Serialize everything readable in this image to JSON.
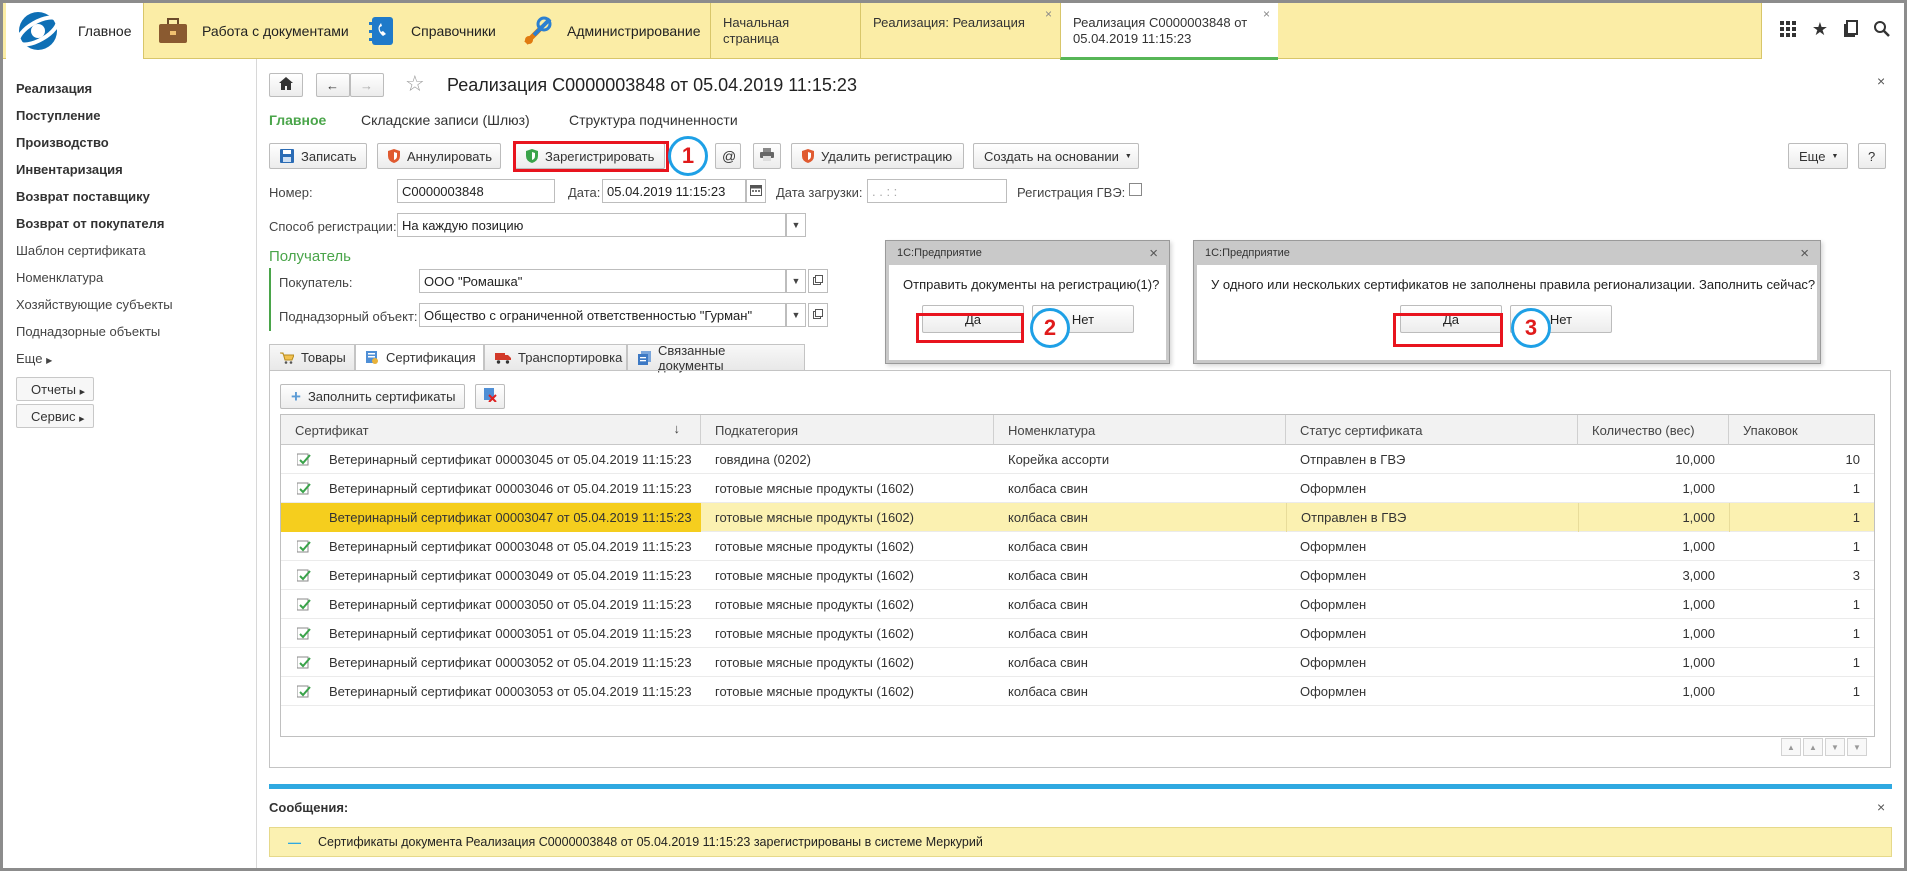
{
  "sections": [
    {
      "label": "Главное"
    },
    {
      "label": "Работа с документами"
    },
    {
      "label": "Справочники"
    },
    {
      "label": "Администрирование"
    }
  ],
  "open_tabs": [
    {
      "label": "Начальная страница"
    },
    {
      "label": "Реализация: Реализация"
    },
    {
      "label": "Реализация С0000003848 от 05.04.2019 11:15:23"
    }
  ],
  "top_icons": [
    "apps-grid-icon",
    "star-icon",
    "history-icon",
    "search-icon"
  ],
  "sidebar": {
    "bold": [
      "Реализация",
      "Поступление",
      "Производство",
      "Инвентаризация",
      "Возврат поставщику",
      "Возврат от покупателя"
    ],
    "normal": [
      "Шаблон сертификата",
      "Номенклатура",
      "Хозяйствующие субъекты",
      "Поднадзорные объекты"
    ],
    "more": "Еще",
    "buttons": [
      "Отчеты",
      "Сервис"
    ]
  },
  "form": {
    "title": "Реализация С0000003848 от 05.04.2019 11:15:23",
    "nav_links": [
      "Главное",
      "Складские записи (Шлюз)",
      "Структура подчиненности"
    ],
    "toolbar": {
      "save": "Записать",
      "cancel": "Аннулировать",
      "register": "Зарегистрировать",
      "email": "@",
      "delete_reg": "Удалить регистрацию",
      "create_based": "Создать на основании",
      "more": "Еще",
      "help": "?"
    },
    "fields": {
      "number_label": "Номер:",
      "number": "С0000003848",
      "date_label": "Дата:",
      "date": "05.04.2019 11:15:23",
      "load_date_label": "Дата загрузки:",
      "load_date": ".  .      :  :",
      "gve_label": "Регистрация ГВЭ:",
      "reg_method_label": "Способ регистрации:",
      "reg_method": "На каждую позицию"
    },
    "recipient": {
      "heading": "Получатель",
      "buyer_label": "Покупатель:",
      "buyer": "ООО \"Ромашка\"",
      "supervised_label": "Поднадзорный объект:",
      "supervised": "Общество с ограниченной ответственностью \"Гурман\""
    },
    "tabs": [
      "Товары",
      "Сертификация",
      "Транспортировка",
      "Связанные документы"
    ],
    "fill_button": "Заполнить сертификаты"
  },
  "grid": {
    "columns": [
      "Сертификат",
      "Подкатегория",
      "Номенклатура",
      "Статус сертификата",
      "Количество (вес)",
      "Упаковок"
    ],
    "rows": [
      {
        "cert": "Ветеринарный сертификат 00003045 от 05.04.2019 11:15:23",
        "sub": "говядина (0202)",
        "nom": "Корейка ассорти",
        "status": "Отправлен в ГВЭ",
        "qty": "10,000",
        "packs": "10"
      },
      {
        "cert": "Ветеринарный сертификат 00003046 от 05.04.2019 11:15:23",
        "sub": "готовые мясные продукты (1602)",
        "nom": "колбаса свин",
        "status": "Оформлен",
        "qty": "1,000",
        "packs": "1"
      },
      {
        "cert": "Ветеринарный сертификат 00003047 от 05.04.2019 11:15:23",
        "sub": "готовые мясные продукты (1602)",
        "nom": "колбаса свин",
        "status": "Отправлен в ГВЭ",
        "qty": "1,000",
        "packs": "1"
      },
      {
        "cert": "Ветеринарный сертификат 00003048 от 05.04.2019 11:15:23",
        "sub": "готовые мясные продукты (1602)",
        "nom": "колбаса свин",
        "status": "Оформлен",
        "qty": "1,000",
        "packs": "1"
      },
      {
        "cert": "Ветеринарный сертификат 00003049 от 05.04.2019 11:15:23",
        "sub": "готовые мясные продукты (1602)",
        "nom": "колбаса свин",
        "status": "Оформлен",
        "qty": "3,000",
        "packs": "3"
      },
      {
        "cert": "Ветеринарный сертификат 00003050 от 05.04.2019 11:15:23",
        "sub": "готовые мясные продукты (1602)",
        "nom": "колбаса свин",
        "status": "Оформлен",
        "qty": "1,000",
        "packs": "1"
      },
      {
        "cert": "Ветеринарный сертификат 00003051 от 05.04.2019 11:15:23",
        "sub": "готовые мясные продукты (1602)",
        "nom": "колбаса свин",
        "status": "Оформлен",
        "qty": "1,000",
        "packs": "1"
      },
      {
        "cert": "Ветеринарный сертификат 00003052 от 05.04.2019 11:15:23",
        "sub": "готовые мясные продукты (1602)",
        "nom": "колбаса свин",
        "status": "Оформлен",
        "qty": "1,000",
        "packs": "1"
      },
      {
        "cert": "Ветеринарный сертификат 00003053 от 05.04.2019 11:15:23",
        "sub": "готовые мясные продукты (1602)",
        "nom": "колбаса свин",
        "status": "Оформлен",
        "qty": "1,000",
        "packs": "1"
      }
    ]
  },
  "dialogs": [
    {
      "title": "1С:Предприятие",
      "message": "Отправить документы на регистрацию(1)?",
      "yes": "Да",
      "no": "Нет"
    },
    {
      "title": "1С:Предприятие",
      "message": "У одного или нескольких сертификатов не заполнены правила регионализации. Заполнить сейчас?",
      "yes": "Да",
      "no": "Нет"
    }
  ],
  "markers": [
    "1",
    "2",
    "3"
  ],
  "messages": {
    "title": "Сообщения:",
    "text": "Сертификаты документа Реализация С0000003848 от 05.04.2019 11:15:23 зарегистрированы в системе Меркурий",
    "collapse": "—"
  },
  "colors": {
    "top_bar": "#fbeda6",
    "accent_green": "#4aa54a",
    "selected_row": "#fbf1b1",
    "highlight_red": "#e8141e",
    "marker_blue": "#1ea0e6",
    "message_bar": "#2fa9e1"
  }
}
